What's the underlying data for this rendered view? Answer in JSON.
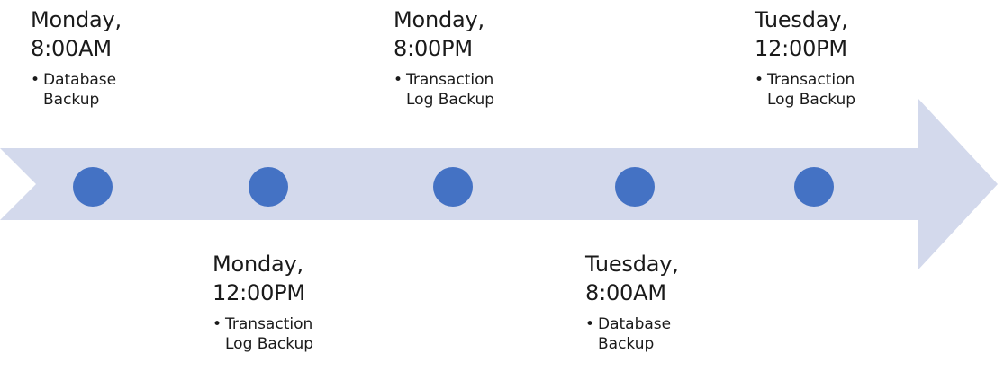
{
  "colors": {
    "arrow": "#d3d9ec",
    "marker": "#4472c4",
    "text": "#1a1a1a"
  },
  "events": [
    {
      "title_line1": "Monday,",
      "title_line2": "8:00AM",
      "item": "Database Backup"
    },
    {
      "title_line1": "Monday,",
      "title_line2": "12:00PM",
      "item": "Transaction Log Backup"
    },
    {
      "title_line1": "Monday,",
      "title_line2": "8:00PM",
      "item": "Transaction Log Backup"
    },
    {
      "title_line1": "Tuesday,",
      "title_line2": "8:00AM",
      "item": "Database Backup"
    },
    {
      "title_line1": "Tuesday,",
      "title_line2": "12:00PM",
      "item": "Transaction Log Backup"
    }
  ],
  "bullet_glyph": "•"
}
